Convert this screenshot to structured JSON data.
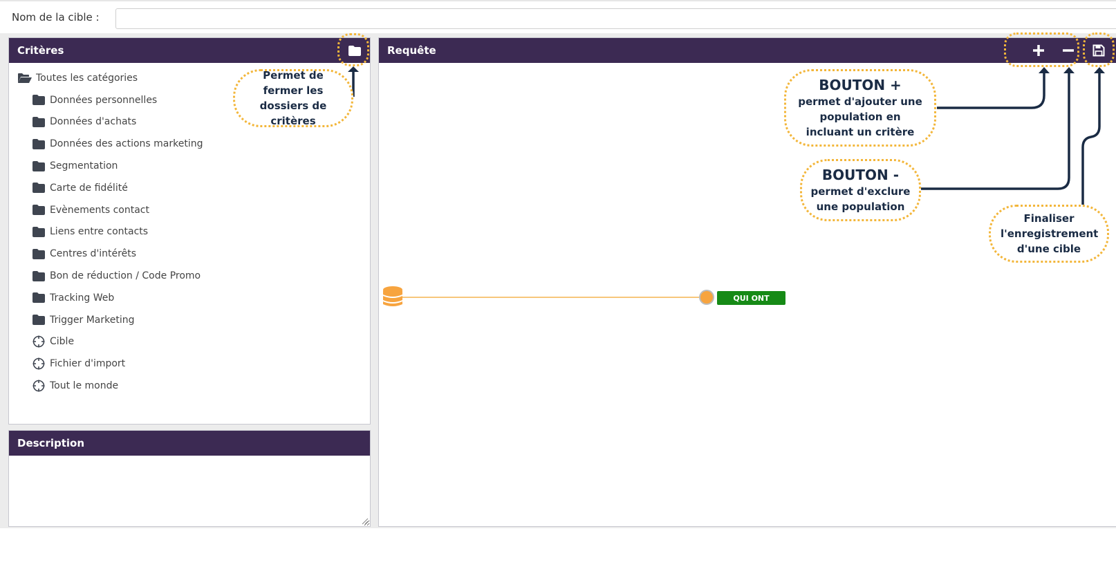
{
  "target": {
    "label": "Nom de la cible :",
    "value": "",
    "placeholder": ""
  },
  "criteria": {
    "title": "Critères",
    "items": [
      {
        "label": "Toutes les catégories",
        "icon": "folder-open-icon"
      },
      {
        "label": "Données personnelles",
        "icon": "folder-icon"
      },
      {
        "label": "Données d'achats",
        "icon": "folder-icon"
      },
      {
        "label": "Données des actions marketing",
        "icon": "folder-icon"
      },
      {
        "label": "Segmentation",
        "icon": "folder-icon"
      },
      {
        "label": "Carte de fidélité",
        "icon": "folder-icon"
      },
      {
        "label": "Evènements contact",
        "icon": "folder-icon"
      },
      {
        "label": "Liens entre contacts",
        "icon": "folder-icon"
      },
      {
        "label": "Centres d'intérêts",
        "icon": "folder-icon"
      },
      {
        "label": "Bon de réduction / Code Promo",
        "icon": "folder-icon"
      },
      {
        "label": "Tracking Web",
        "icon": "folder-icon"
      },
      {
        "label": "Trigger Marketing",
        "icon": "folder-icon"
      },
      {
        "label": "Cible",
        "icon": "crosshair-icon"
      },
      {
        "label": "Fichier d'import",
        "icon": "crosshair-icon"
      },
      {
        "label": "Tout le monde",
        "icon": "crosshair-icon"
      }
    ]
  },
  "description": {
    "title": "Description",
    "value": ""
  },
  "requete": {
    "title": "Requête",
    "node_label": "QUI ONT"
  },
  "callouts": {
    "folder": {
      "text": "Permet de fermer les dossiers de critères"
    },
    "plus": {
      "title": "BOUTON +",
      "text": "permet d'ajouter une population en incluant un critère"
    },
    "minus": {
      "title": "BOUTON -",
      "text": "permet d'exclure une population"
    },
    "save": {
      "text": "Finaliser l'enregistrement d'une cible"
    }
  },
  "colors": {
    "header": "#3c2a53",
    "accent_orange": "#f7a43f",
    "callout_border": "#f3b63a",
    "qui_ont": "#168a16",
    "arrow": "#1a2b44"
  }
}
